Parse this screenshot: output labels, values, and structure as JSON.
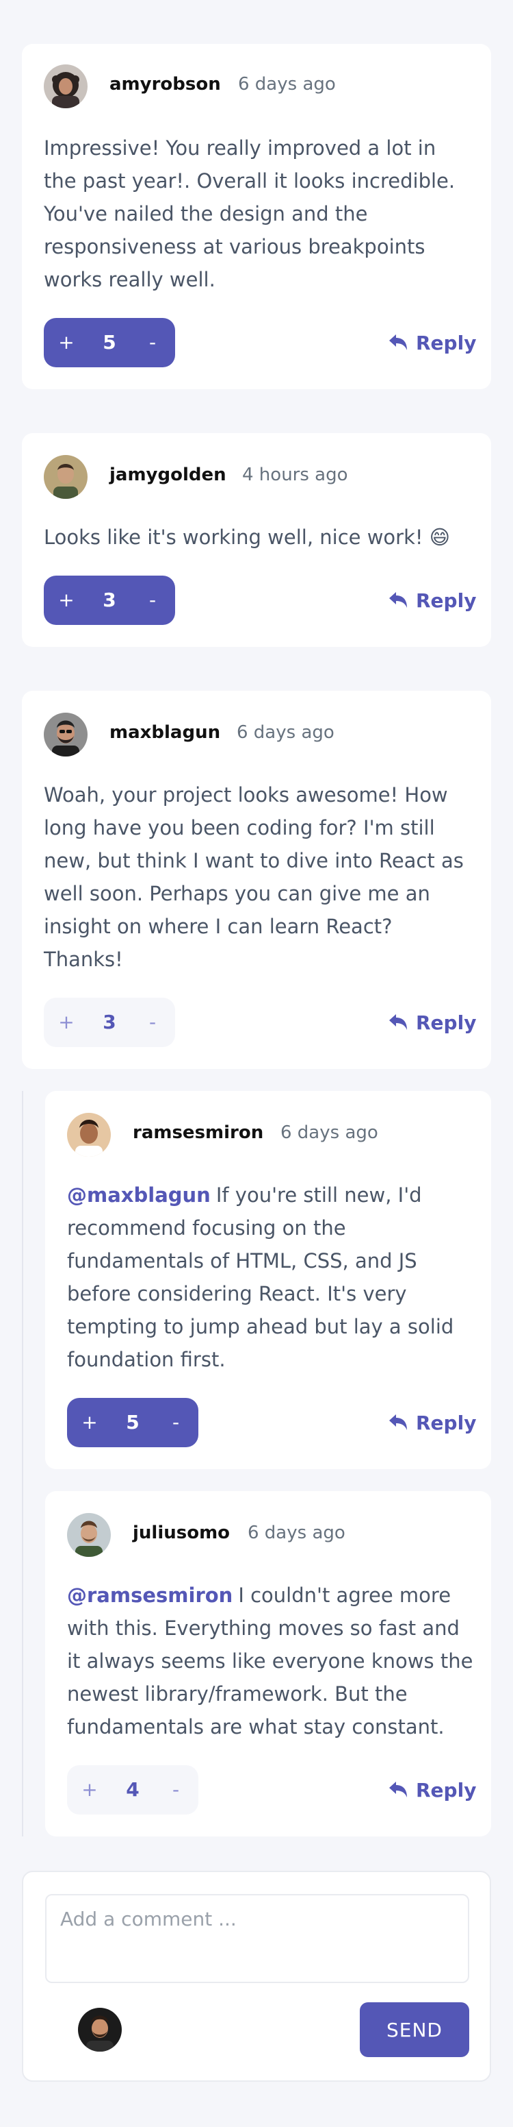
{
  "comments": [
    {
      "username": "amyrobson",
      "timestamp": "6 days ago",
      "text": "Impressive! You really improved a lot in the past year!. Overall it looks incredible. You've nailed the design and the responsiveness at various breakpoints works really well.",
      "score": "5",
      "vote_active": true
    },
    {
      "username": "jamygolden",
      "timestamp": "4 hours ago",
      "text": "Looks like it's working well, nice work! 😄",
      "score": "3",
      "vote_active": true
    },
    {
      "username": "maxblagun",
      "timestamp": "6 days ago",
      "text": "Woah, your project looks awesome! How long have you been coding for? I'm still new, but think I want to dive into React as well soon. Perhaps you can give me an insight on where I can learn React? Thanks!",
      "score": "3",
      "vote_active": false
    }
  ],
  "replies": [
    {
      "username": "ramsesmiron",
      "timestamp": "6 days ago",
      "mention": "@maxblagun",
      "text": "If you're still new, I'd recommend focusing on the fundamentals of HTML, CSS, and JS before considering React. It's very tempting to jump ahead but lay a solid foundation first.",
      "score": "5",
      "vote_active": true
    },
    {
      "username": "juliusomo",
      "timestamp": "6 days ago",
      "mention": "@ramsesmiron",
      "text": "I couldn't agree more with this. Everything moves so fast and it always seems like everyone knows the newest library/framework. But the fundamentals are what stay constant.",
      "score": "4",
      "vote_active": false
    }
  ],
  "labels": {
    "plus": "+",
    "minus": "-",
    "reply": "Reply"
  },
  "compose": {
    "placeholder": "Add a comment ...",
    "value": "",
    "send_label": "SEND"
  },
  "icons": {
    "reply": "reply-arrow-icon"
  },
  "colors": {
    "accent": "#5457b6",
    "accent_light": "#8d8fd3",
    "background": "#f5f6fa",
    "text": "#4a5566",
    "muted": "#67727e"
  }
}
